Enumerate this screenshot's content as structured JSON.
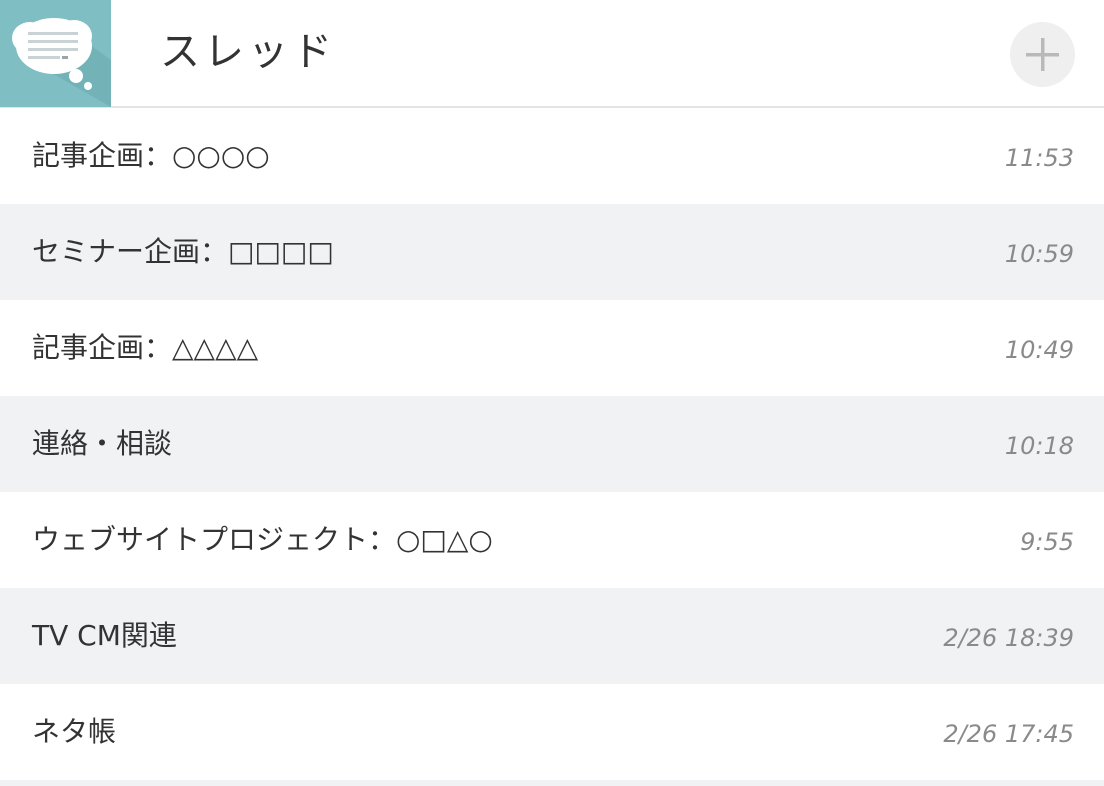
{
  "header": {
    "title": "スレッド",
    "app_icon": "chat-bubble-icon",
    "add_button_icon": "plus-icon"
  },
  "threads": [
    {
      "title": "記事企画：○○○○",
      "time": "11:53"
    },
    {
      "title": "セミナー企画：□□□□",
      "time": "10:59"
    },
    {
      "title": "記事企画：△△△△",
      "time": "10:49"
    },
    {
      "title": "連絡・相談",
      "time": "10:18"
    },
    {
      "title": "ウェブサイトプロジェクト：○□△○",
      "time": "9:55"
    },
    {
      "title": "TV CM関連",
      "time": "2/26 18:39"
    },
    {
      "title": "ネタ帳",
      "time": "2/26 17:45"
    }
  ],
  "colors": {
    "icon_background": "#7fbfc4",
    "row_alt": "#f1f2f4",
    "text": "#333333",
    "time_text": "#8a8a8a"
  }
}
